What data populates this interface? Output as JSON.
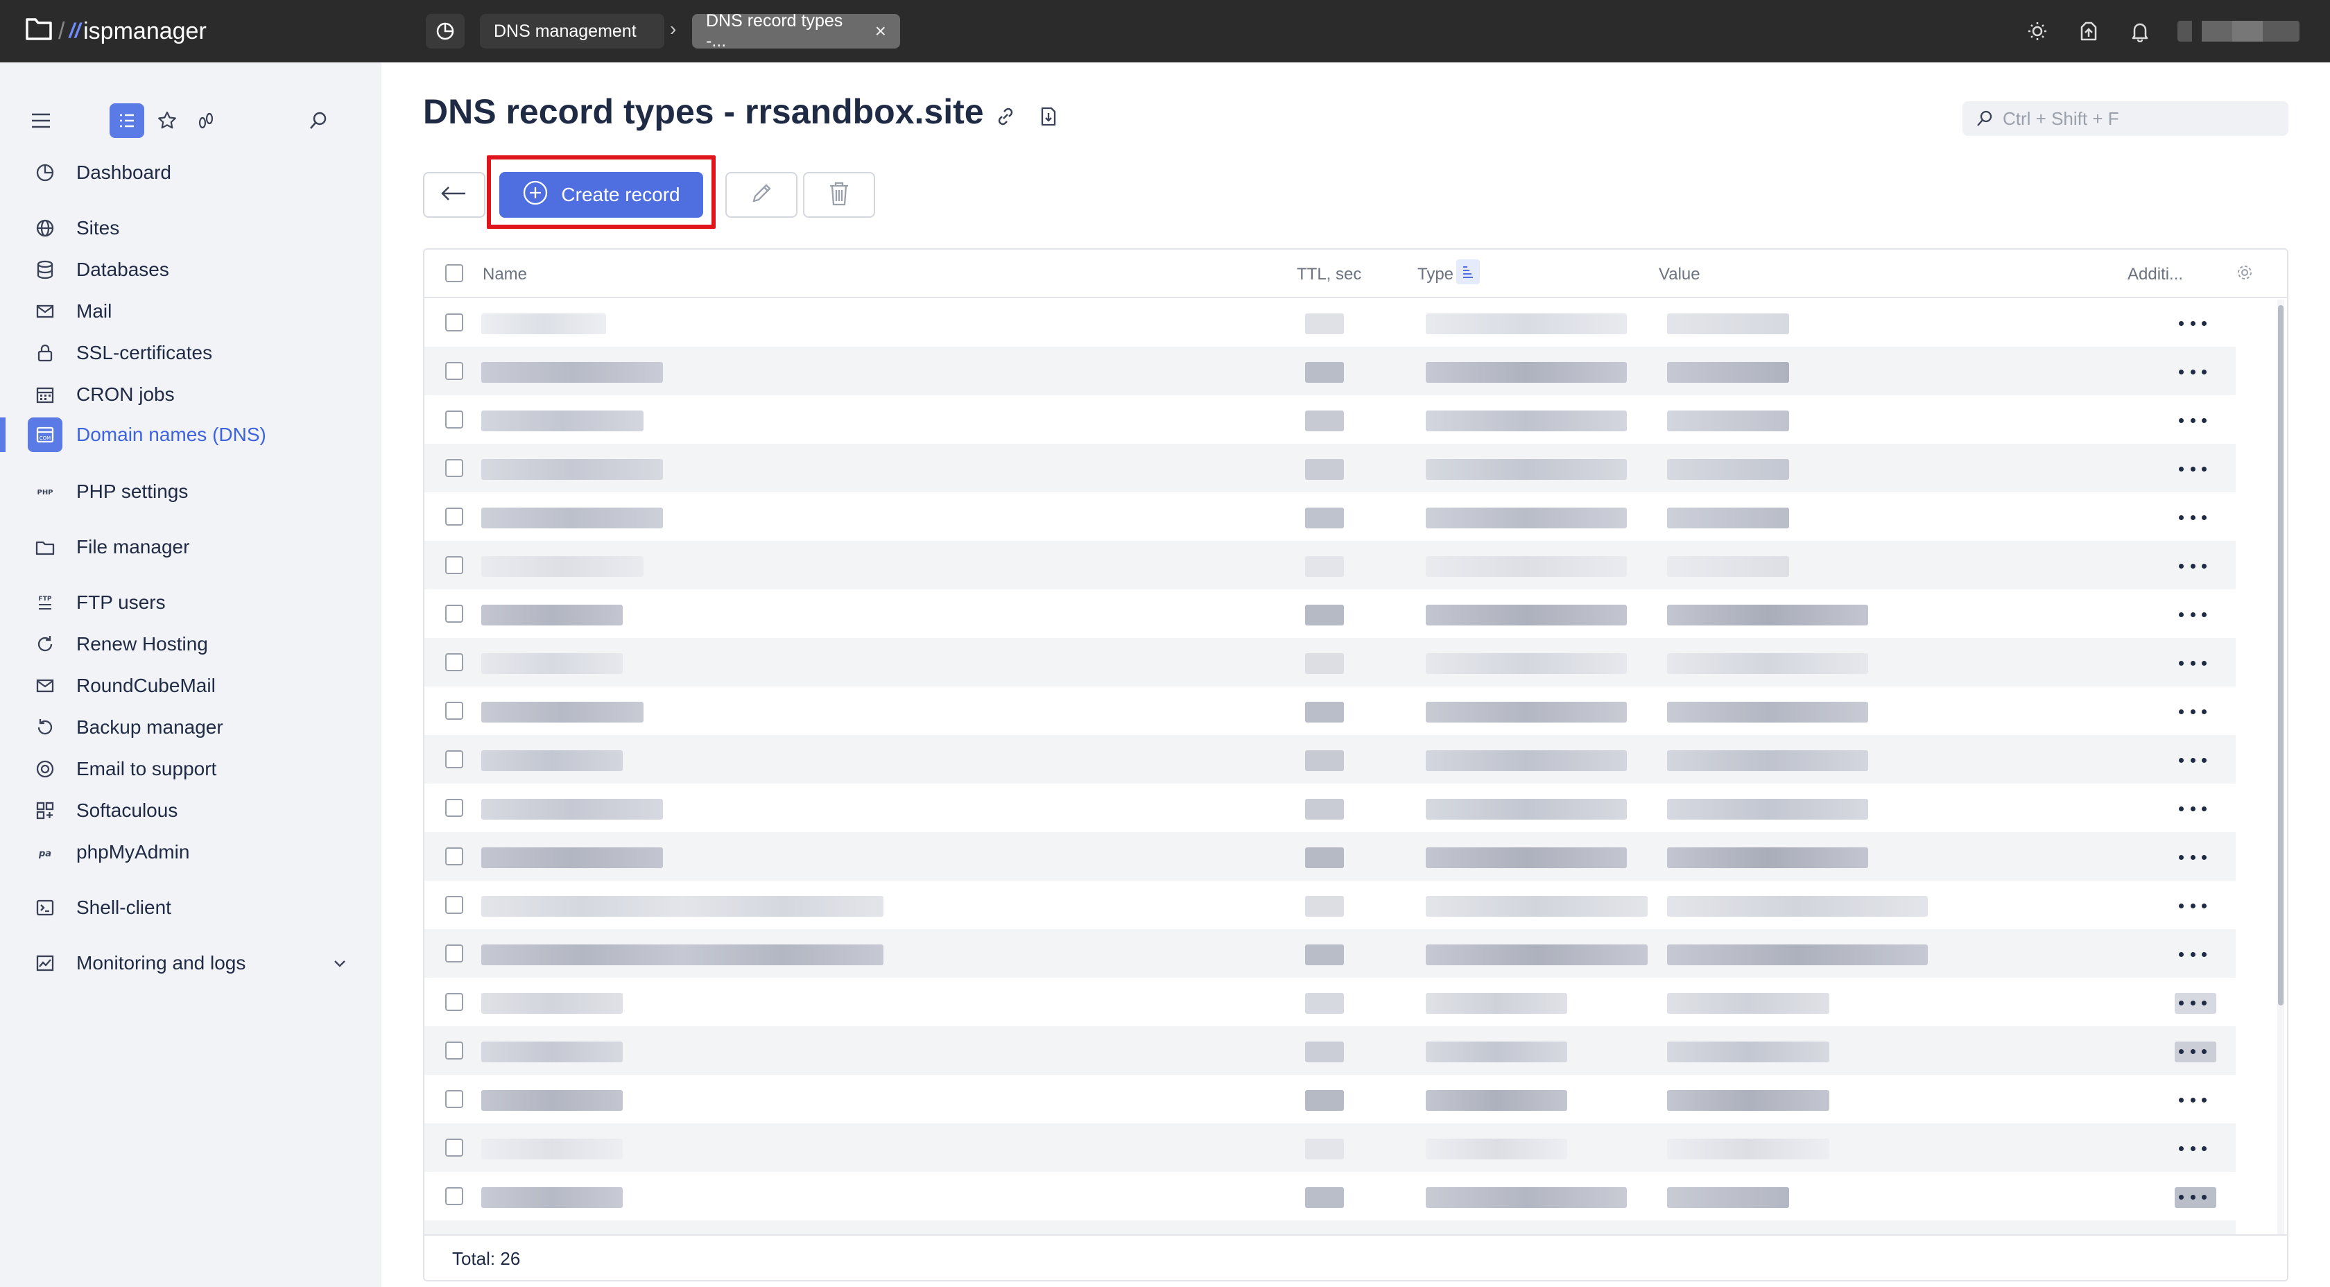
{
  "topbar": {
    "brand": "ispmanager",
    "breadcrumbs": [
      "DNS management",
      "DNS record types -..."
    ]
  },
  "sidebar": {
    "items": [
      {
        "label": "Dashboard",
        "icon": "dashboard-icon"
      },
      {
        "label": "Sites",
        "icon": "globe-icon"
      },
      {
        "label": "Databases",
        "icon": "database-icon"
      },
      {
        "label": "Mail",
        "icon": "mail-icon"
      },
      {
        "label": "SSL-certificates",
        "icon": "lock-icon"
      },
      {
        "label": "CRON jobs",
        "icon": "calendar-icon"
      },
      {
        "label": "Domain names (DNS)",
        "icon": "dns-icon",
        "active": true
      },
      {
        "label": "PHP settings",
        "icon": "php-icon"
      },
      {
        "label": "File manager",
        "icon": "folder-icon"
      },
      {
        "label": "FTP users",
        "icon": "ftp-icon"
      },
      {
        "label": "Renew Hosting",
        "icon": "refresh-icon"
      },
      {
        "label": "RoundCubeMail",
        "icon": "mail-icon"
      },
      {
        "label": "Backup manager",
        "icon": "backup-icon"
      },
      {
        "label": "Email to support",
        "icon": "support-icon"
      },
      {
        "label": "Softaculous",
        "icon": "apps-icon"
      },
      {
        "label": "phpMyAdmin",
        "icon": "phpmyadmin-icon"
      },
      {
        "label": "Shell-client",
        "icon": "terminal-icon"
      },
      {
        "label": "Monitoring and logs",
        "icon": "chart-icon"
      }
    ]
  },
  "main": {
    "title": "DNS record types - rrsandbox.site",
    "search_placeholder": "Ctrl + Shift + F",
    "create_label": "Create record",
    "columns": {
      "name": "Name",
      "ttl": "TTL, sec",
      "type": "Type",
      "value": "Value",
      "additional": "Additi..."
    },
    "total": "Total: 26"
  },
  "colors": {
    "accent": "#4f6fe0",
    "highlight": "#e0141b",
    "topbar": "#2b2b2b",
    "sidebar": "#f2f3f6"
  }
}
